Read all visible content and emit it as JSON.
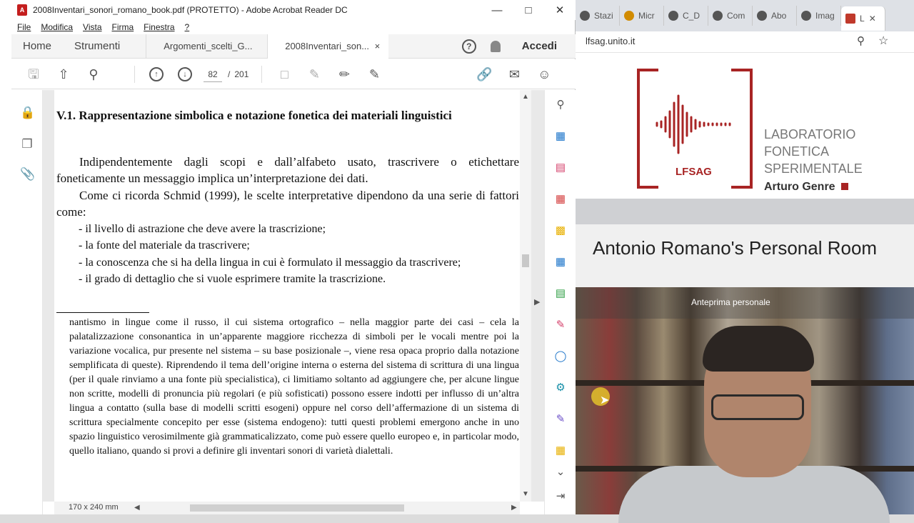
{
  "acrobat": {
    "window_title": "2008Inventari_sonori_romano_book.pdf (PROTETTO) - Adobe Acrobat Reader DC",
    "menu": [
      "File",
      "Modifica",
      "Vista",
      "Firma",
      "Finestra",
      "?"
    ],
    "tabs": {
      "home": "Home",
      "tools": "Strumenti",
      "doc1": "Argomenti_scelti_G...",
      "doc2": "2008Inventari_son...",
      "close": "×",
      "login": "Accedi"
    },
    "toolbar": {
      "current_page": "82",
      "separator": "/",
      "total_pages": "201"
    },
    "status": {
      "page_size": "170 x 240 mm"
    },
    "document": {
      "heading": "V.1. Rappresentazione simbolica e notazione fonetica dei materiali linguistici",
      "para1": "Indipendentemente dagli scopi e dall’alfabeto usato, trascrivere o etichettare foneticamente un messaggio implica un’interpretazione dei dati.",
      "para2": "Come ci ricorda Schmid (1999), le scelte interpretative dipendono da una serie di fattori come:",
      "bullets": [
        "- il livello di astrazione che deve avere la trascrizione;",
        "- la fonte del materiale da trascrivere;",
        "- la conoscenza che si ha della lingua in cui è formulato il messaggio da trascrivere;",
        "- il grado di dettaglio che si vuole esprimere tramite la trascrizione."
      ],
      "footnote": "nantismo in lingue come il russo, il cui sistema ortografico – nella maggior parte dei casi – cela la palatalizzazione consonantica in un’apparente maggiore ricchezza di simboli per le vocali mentre poi la variazione vocalica, pur presente nel sistema – su base posizionale –, viene resa opaca proprio dalla notazione semplificata di queste). Riprendendo il tema dell’origine interna o esterna del sistema di scrittura di una lingua (per il quale rinviamo a una fonte più specialistica), ci limitiamo soltanto ad aggiungere che, per alcune lingue non scritte, modelli di pronuncia più regolari (e più sofisticati) possono essere indotti per influsso di un’altra lingua a contatto (sulla base di modelli scritti esogeni) oppure nel corso dell’affermazione di un sistema di scrittura specialmente concepito per esse (sistema endogeno): tutti questi problemi emergono anche in uno spazio linguistico verosimilmente già grammaticalizzato, come può essere quello europeo e, in particolar modo, quello italiano, quando si provi a definire gli inventari sonori di varietà dialettali."
    }
  },
  "browser": {
    "tabs": [
      "Stazi",
      "Micr",
      "C_D",
      "Com",
      "Abo",
      "Imag",
      "L"
    ],
    "url": "lfsag.unito.it",
    "logo": {
      "short": "LFSAG",
      "line1": "LABORATORIO",
      "line2": "FONETICA",
      "line3": "SPERIMENTALE",
      "line4": "Arturo Genre"
    },
    "room_title": "Antonio Romano's Personal Room",
    "video_caption": "Anteprima personale"
  },
  "colors": {
    "brand_red": "#a82424",
    "acrobat_icon_blue": "#1a73c9"
  }
}
